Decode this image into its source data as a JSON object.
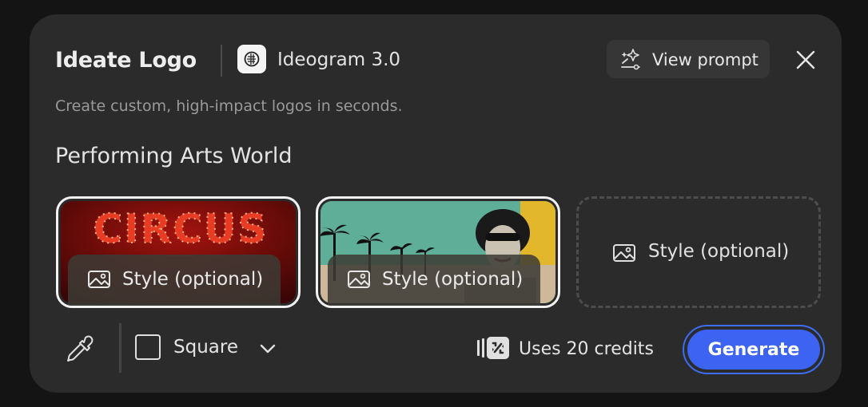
{
  "dialog": {
    "title": "Ideate Logo",
    "model_name": "Ideogram 3.0",
    "view_prompt_label": "View prompt",
    "subtitle": "Create custom, high-impact logos in seconds.",
    "prompt": "Performing Arts World"
  },
  "style_references": [
    {
      "label": "Style (optional)",
      "thumbnail": "circus marquee lettering",
      "thumb_text": "CIRCUS"
    },
    {
      "label": "Style (optional)",
      "thumbnail": "retro palm tree collage"
    },
    {
      "label": "Style (optional)",
      "thumbnail": null
    }
  ],
  "footer": {
    "aspect_label": "Square",
    "credits_label": "Uses 20 credits",
    "generate_label": "Generate"
  },
  "colors": {
    "panel": "#2b2b2b",
    "accent": "#3c63f2"
  },
  "icons": {
    "view_prompt": "sparkle-wand-icon",
    "close": "close-icon",
    "image": "image-icon",
    "eyedropper": "eyedropper-icon",
    "aspect": "square-icon",
    "dropdown": "chevron-down-icon",
    "credits": "credits-icon"
  }
}
